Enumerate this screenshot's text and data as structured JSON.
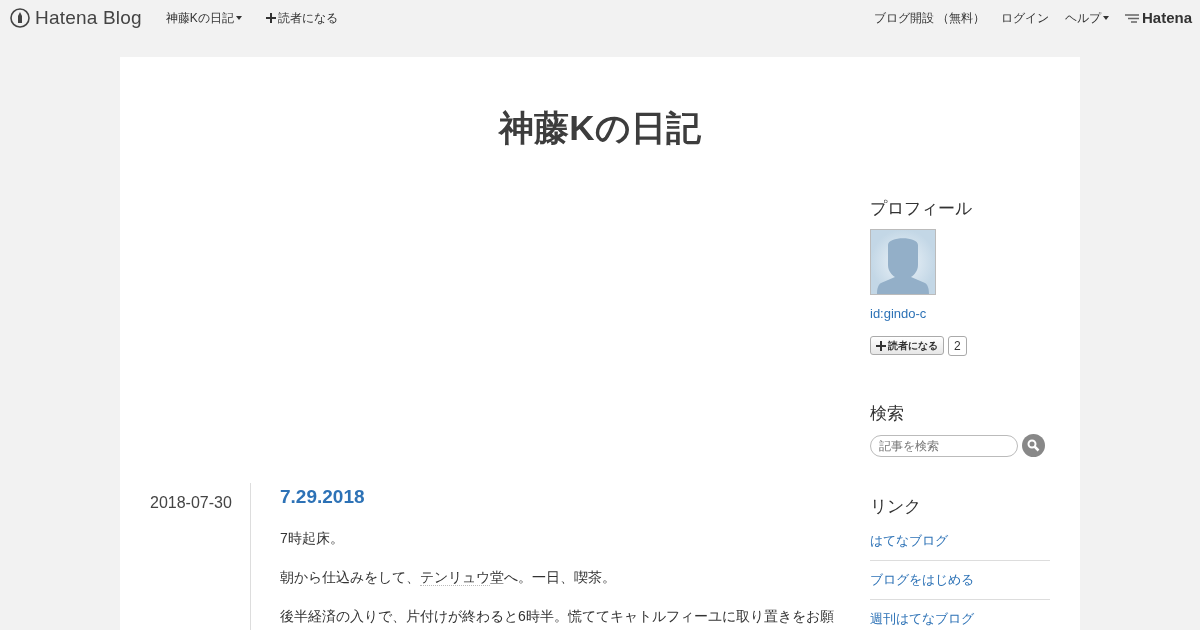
{
  "topbar": {
    "logo": "Hatena Blog",
    "left_items": [
      {
        "label": "神藤Kの日記",
        "kind": "dropdown"
      },
      {
        "label": "読者になる",
        "kind": "plus"
      }
    ],
    "right_items": [
      {
        "label": "ブログ開設 （無料）",
        "kind": "plain"
      },
      {
        "label": "ログイン",
        "kind": "plain"
      },
      {
        "label": "ヘルプ",
        "kind": "dropdown"
      }
    ],
    "brand": "Hatena"
  },
  "blog_title": "神藤Kの日記",
  "entry": {
    "date": "2018-07-30",
    "title": "7.29.2018",
    "paragraphs": [
      [
        {
          "kind": "text",
          "text": "7時起床。"
        }
      ],
      [
        {
          "kind": "text",
          "text": "朝から仕込みをして、"
        },
        {
          "kind": "keyword",
          "text": "テンリュウ"
        },
        {
          "kind": "text",
          "text": "堂へ。一日、喫茶。"
        }
      ],
      [
        {
          "kind": "text",
          "text": "後半経済の入りで、片付けが終わると6時半。慌ててキャトルフィーユに取り置きをお願"
        }
      ]
    ]
  },
  "sidebar": {
    "profile": {
      "heading": "プロフィール",
      "user_id": "id:gindo-c",
      "subscribe_label": "読者になる",
      "subscriber_count": "2"
    },
    "search": {
      "heading": "検索",
      "placeholder": "記事を検索"
    },
    "links": {
      "heading": "リンク",
      "items": [
        "はてなブログ",
        "ブログをはじめる",
        "週刊はてなブログ"
      ]
    }
  }
}
